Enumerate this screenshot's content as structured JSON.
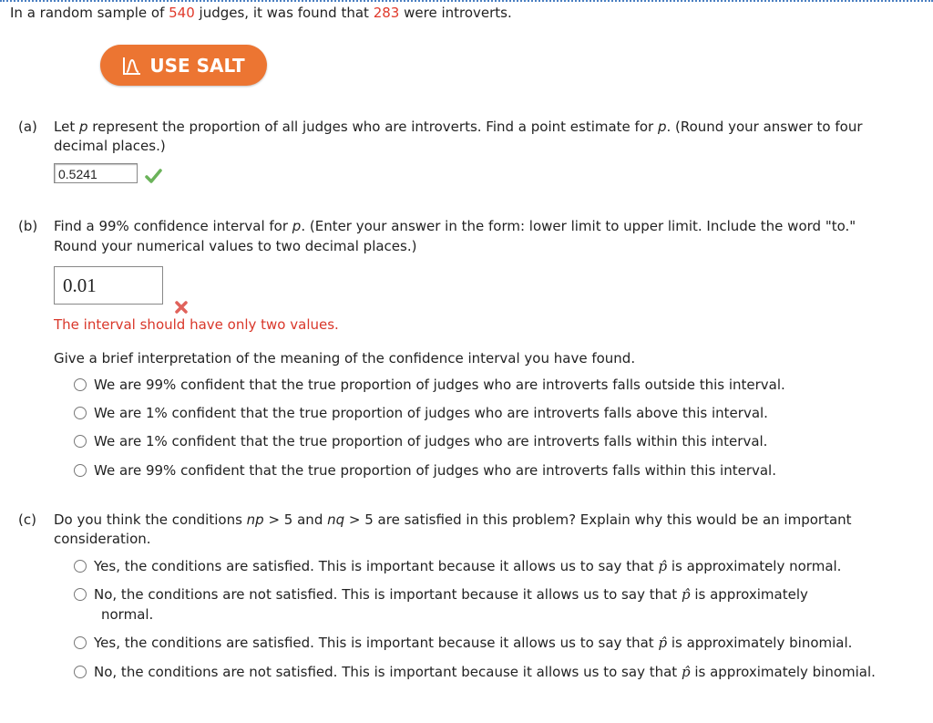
{
  "intro": {
    "prefix": "In a random sample of ",
    "n": "540",
    "middle": " judges, it was found that ",
    "x": "283",
    "suffix": " were introverts."
  },
  "salt_button": {
    "label": "USE SALT",
    "icon": "bell-curve-icon",
    "color": "#ec7532"
  },
  "part_a": {
    "label": "(a)",
    "line1_pre": "Let ",
    "var": "p",
    "line1_mid": " represent the proportion of all judges who are introverts. Find a point estimate for ",
    "line1_post": ". (Round your answer to four",
    "line2": "decimal places.)",
    "answer": "0.5241",
    "status": "correct"
  },
  "part_b": {
    "label": "(b)",
    "line1_pre": "Find a 99% confidence interval for ",
    "var": "p",
    "line1_post": ". (Enter your answer in the form: lower limit to upper limit. Include the word \"to.\"",
    "line2": "Round your numerical values to two decimal places.)",
    "answer": "0.01",
    "status": "incorrect",
    "error_message": "The interval should have only two values.",
    "interpretation_prompt": "Give a brief interpretation of the meaning of the confidence interval you have found.",
    "options": [
      "We are 99% confident that the true proportion of judges who are introverts falls outside this interval.",
      "We are 1% confident that the true proportion of judges who are introverts falls above this interval.",
      "We are 1% confident that the true proportion of judges who are introverts falls within this interval.",
      "We are 99% confident that the true proportion of judges who are introverts falls within this interval."
    ]
  },
  "part_c": {
    "label": "(c)",
    "q_pre": "Do you think the conditions ",
    "np": "np",
    "cond1": " > 5 and ",
    "nq": "nq",
    "q_post": " > 5 are satisfied in this problem? Explain why this would be an important",
    "line2": "consideration.",
    "phat": "p̂",
    "options": [
      {
        "pre": "Yes, the conditions are satisfied. This is important because it allows us to say that ",
        "post": " is approximately normal."
      },
      {
        "pre": "No, the conditions are not satisfied. This is important because it allows us to say that ",
        "post": " is approximately",
        "post2": "normal."
      },
      {
        "pre": "Yes, the conditions are satisfied. This is important because it allows us to say that ",
        "post": " is approximately binomial."
      },
      {
        "pre": "No, the conditions are not satisfied. This is important because it allows us to say that ",
        "post": " is approximately binomial."
      }
    ]
  }
}
